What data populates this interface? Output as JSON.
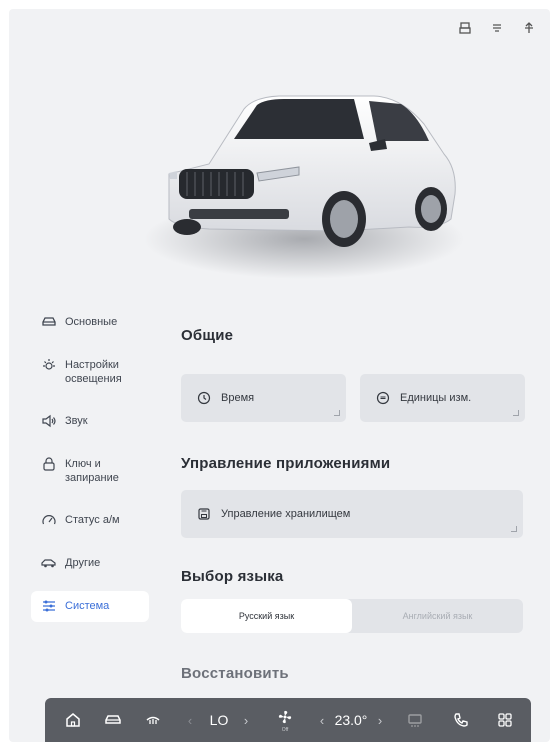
{
  "sidebar": {
    "items": [
      {
        "label": "Основные",
        "icon": "car-outline-icon"
      },
      {
        "label": "Настройки\nосвещения",
        "icon": "light-icon"
      },
      {
        "label": "Звук",
        "icon": "speaker-icon"
      },
      {
        "label": "Ключ и\nзапирание",
        "icon": "lock-icon"
      },
      {
        "label": "Статус а/м",
        "icon": "gauge-icon"
      },
      {
        "label": "Другие",
        "icon": "car-side-icon"
      },
      {
        "label": "Система",
        "icon": "sliders-icon",
        "active": true
      }
    ]
  },
  "main": {
    "general_title": "Общие",
    "tiles": [
      {
        "label": "Время",
        "icon": "clock-icon"
      },
      {
        "label": "Единицы изм.",
        "icon": "units-icon"
      }
    ],
    "apps_title": "Управление приложениями",
    "storage_label": "Управление хранилищем",
    "language_title": "Выбор языка",
    "languages": [
      {
        "label": "Русский язык",
        "selected": true
      },
      {
        "label": "Английский язык",
        "selected": false
      }
    ],
    "restore_title": "Восстановить"
  },
  "dock": {
    "left_temp": "LO",
    "fan_label": "Off",
    "right_temp": "23.0°",
    "left_arrow": "‹",
    "right_arrow": "›"
  },
  "colors": {
    "accent": "#3b6fd8",
    "background": "#f1f2f4",
    "tile": "#e2e4e8",
    "dock": "#5a5d63"
  }
}
